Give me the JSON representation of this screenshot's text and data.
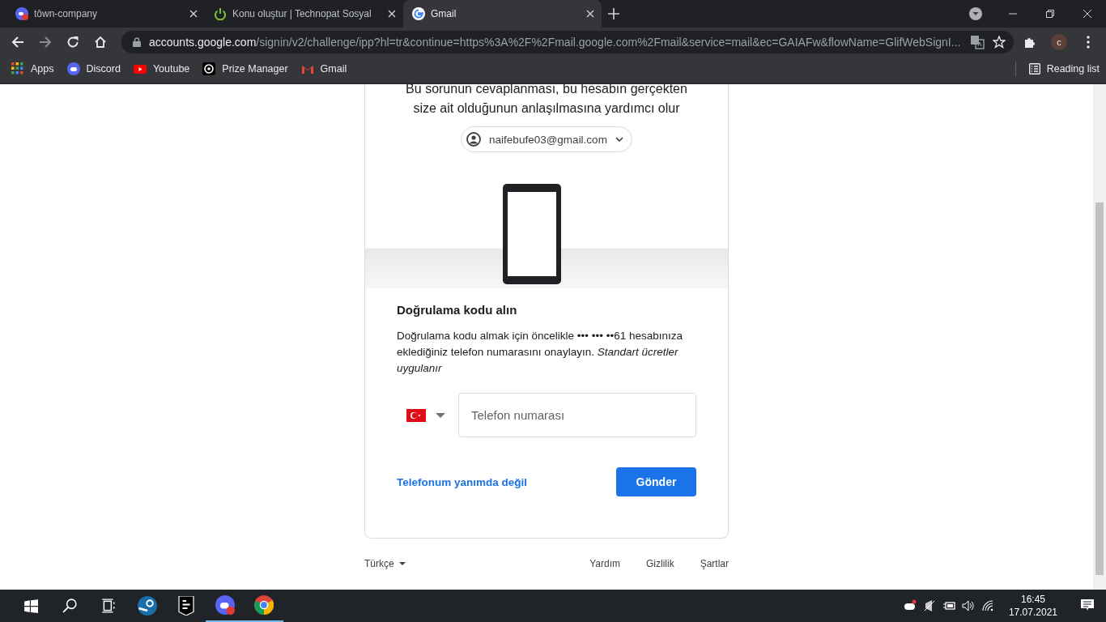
{
  "browser": {
    "tabs": [
      {
        "title": "tôwn-company",
        "selected": false
      },
      {
        "title": "Konu oluştur | Technopat Sosyal",
        "selected": false
      },
      {
        "title": "Gmail",
        "selected": true
      }
    ],
    "address": {
      "host": "accounts.google.com",
      "path": "/signin/v2/challenge/ipp?hl=tr&continue=https%3A%2F%2Fmail.google.com%2Fmail&service=mail&ec=GAIAFw&flowName=GlifWebSignI..."
    },
    "profile_initial": "c",
    "bookmarks": [
      "Apps",
      "Discord",
      "Youtube",
      "Prize Manager",
      "Gmail"
    ],
    "reading_list": "Reading list"
  },
  "page": {
    "intro": "Bu sorunun cevaplanması, bu hesabın gerçekten size ait olduğunun anlaşılmasına yardımcı olur",
    "account": "naifebufe03@gmail.com",
    "heading": "Doğrulama kodu alın",
    "description": "Doğrulama kodu almak için öncelikle ••• ••• ••61 hesabınıza eklediğiniz telefon numarasını onaylayın. *Standart ücretler uygulanır*",
    "phone_field": {
      "placeholder": "Telefon numarası"
    },
    "no_phone_link": "Telefonum yanımda değil",
    "send_button": "Gönder",
    "footer": {
      "language": "Türkçe",
      "links": [
        "Yardım",
        "Gizlilik",
        "Şartlar"
      ]
    }
  },
  "taskbar": {
    "time": "16:45",
    "date": "17.07.2021"
  }
}
